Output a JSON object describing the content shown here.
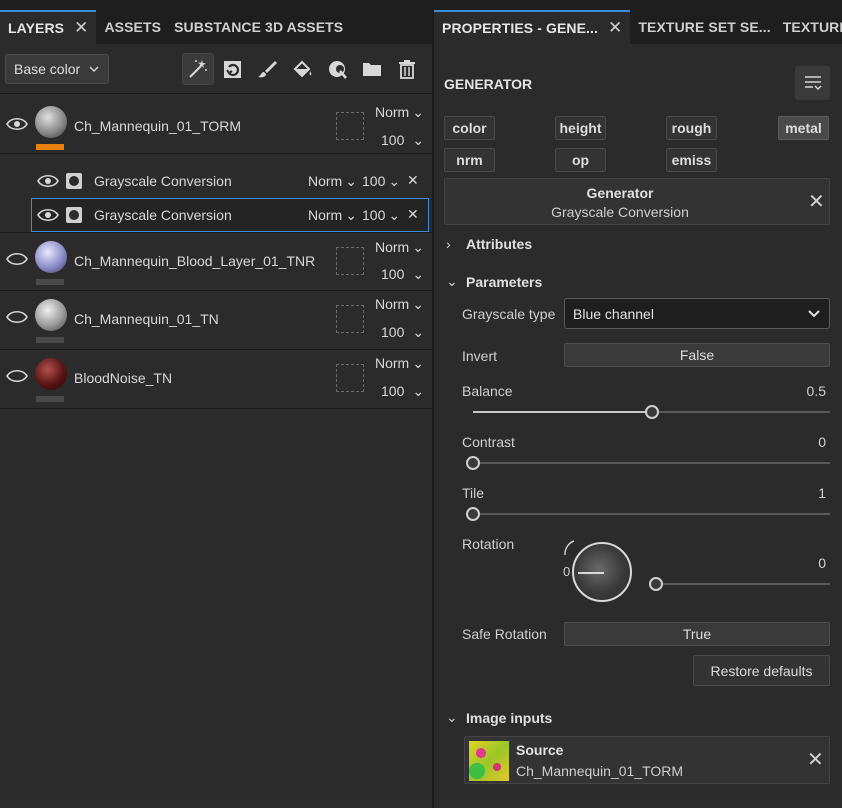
{
  "layers_panel": {
    "tabs": [
      {
        "label": "LAYERS",
        "active": true,
        "closable": true
      },
      {
        "label": "ASSETS",
        "active": false
      },
      {
        "label": "SUBSTANCE 3D ASSETS",
        "active": false
      }
    ],
    "channel_dropdown": "Base color",
    "toolbar_icons": [
      "magic-wand-icon",
      "smart-mask-icon",
      "brush-icon",
      "fill-bucket-icon",
      "color-picker-icon",
      "folder-icon",
      "trash-icon"
    ],
    "layers": [
      {
        "name": "Ch_Mannequin_01_TORM",
        "blend": "Norm",
        "opacity": "100",
        "thumb_color": "#8a8a8a",
        "bar_color": "#e8820c",
        "effects": [
          {
            "name": "Grayscale Conversion",
            "blend": "Norm",
            "opacity": "100",
            "selected": false
          },
          {
            "name": "Grayscale Conversion",
            "blend": "Norm",
            "opacity": "100",
            "selected": true
          }
        ]
      },
      {
        "name": "Ch_Mannequin_Blood_Layer_01_TNR",
        "blend": "Norm",
        "opacity": "100",
        "thumb_color": "#8c8cc8",
        "bar_color": "#4a4a4a"
      },
      {
        "name": "Ch_Mannequin_01_TN",
        "blend": "Norm",
        "opacity": "100",
        "thumb_color": "#9a9a9a",
        "bar_color": "#4a4a4a"
      },
      {
        "name": "BloodNoise_TN",
        "blend": "Norm",
        "opacity": "100",
        "thumb_color": "#5a1414",
        "bar_color": "#4a4a4a"
      }
    ]
  },
  "properties_panel": {
    "tabs": [
      {
        "label": "PROPERTIES - GENE...",
        "active": true,
        "closable": true
      },
      {
        "label": "TEXTURE SET SE...",
        "active": false
      },
      {
        "label": "TEXTURE S...",
        "active": false
      }
    ],
    "section_title": "GENERATOR",
    "channels": [
      {
        "label": "color",
        "active": false
      },
      {
        "label": "height",
        "active": false
      },
      {
        "label": "rough",
        "active": false
      },
      {
        "label": "metal",
        "active": true
      },
      {
        "label": "nrm",
        "active": false
      },
      {
        "label": "op",
        "active": false
      },
      {
        "label": "emiss",
        "active": false
      }
    ],
    "generator": {
      "title": "Generator",
      "name": "Grayscale Conversion"
    },
    "attributes_label": "Attributes",
    "parameters_label": "Parameters",
    "params": {
      "grayscale_type": {
        "label": "Grayscale type",
        "value": "Blue channel"
      },
      "invert": {
        "label": "Invert",
        "value": "False"
      },
      "balance": {
        "label": "Balance",
        "value": "0.5",
        "fraction": 0.5
      },
      "contrast": {
        "label": "Contrast",
        "value": "0",
        "fraction": 0
      },
      "tile": {
        "label": "Tile",
        "value": "1",
        "fraction": 0
      },
      "rotation": {
        "label": "Rotation",
        "value": "0",
        "knob_value": "0",
        "fraction": 0
      },
      "safe_rotation": {
        "label": "Safe Rotation",
        "value": "True"
      }
    },
    "restore_label": "Restore defaults",
    "image_inputs_label": "Image inputs",
    "source": {
      "title": "Source",
      "name": "Ch_Mannequin_01_TORM"
    }
  }
}
